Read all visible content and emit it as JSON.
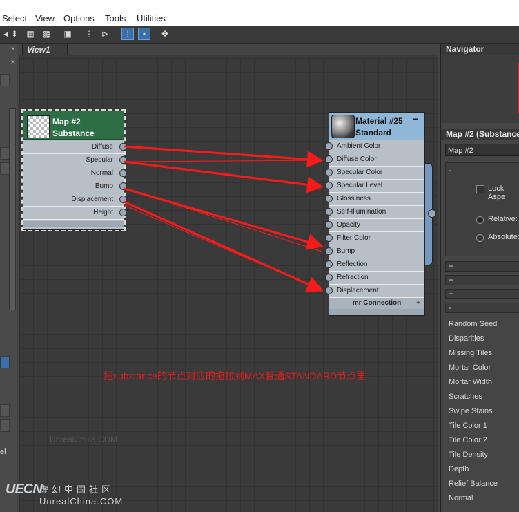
{
  "menu": {
    "items": [
      "Select",
      "View",
      "Options",
      "Tools",
      "Utilities"
    ]
  },
  "toolbar": {
    "icons": [
      "select-arrow-icon",
      "pick-icon",
      "material-map-icon",
      "checker-icon",
      "layout-icon",
      "nav-icon",
      "hierarchy-icon",
      "show-all-icon",
      "toggle-icon",
      "sample-icon"
    ]
  },
  "view": {
    "tab_label": "View1"
  },
  "map_node": {
    "title": "Map #2",
    "subtitle": "Substance",
    "header_color": "#2e6e46",
    "outputs": [
      "Diffuse",
      "Specular",
      "Normal",
      "Bump",
      "Displacement",
      "Height"
    ]
  },
  "material_node": {
    "title": "Material #25",
    "subtitle": "Standard",
    "header_color": "#8fb8d8",
    "collapse_label": "−",
    "inputs": [
      "Ambient Color",
      "Diffuse Color",
      "Specular Color",
      "Specular Level",
      "Glossiness",
      "Self-Illumination",
      "Opacity",
      "Filter Color",
      "Bump",
      "Reflection",
      "Refraction",
      "Displacement"
    ],
    "footer": "mr Connection",
    "footer_expand": "+"
  },
  "wires_color": "#ff1a1a",
  "annotation": "把substance的节点对应的拖拉到MAX普通STANDARD节点里",
  "navigator": {
    "title": "Navigator"
  },
  "params_panel": {
    "title": "Map #2 (Substance",
    "name_field": "Map #2",
    "rollout_minus": "-",
    "lock_aspect": "Lock Aspe",
    "relative": "Relative:",
    "absolute": "Absolute:",
    "rollout_plus": "+",
    "params": [
      "Random Seed",
      "Disparities",
      "Missing Tiles",
      "Mortar Color",
      "Mortar Width",
      "Scratches",
      "Swipe Stains",
      "Tile Color 1",
      "Tile Color 2",
      "Tile Density",
      "Depth",
      "Relief Balance",
      "Normal"
    ]
  },
  "left_panel": {
    "close_label": "×",
    "label_el": "el"
  },
  "watermark": {
    "small": "UnrealChula.COM",
    "logo": "UECN",
    "cn": "虚幻中国社区",
    "url": "UnrealChina.COM"
  }
}
